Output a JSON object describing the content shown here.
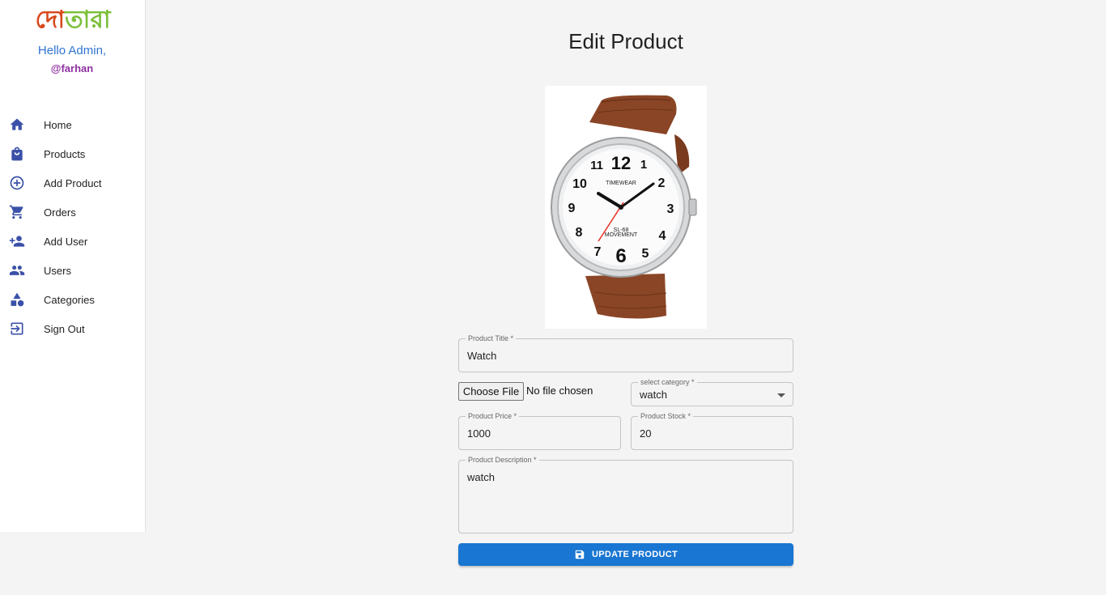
{
  "sidebar": {
    "logo_part1": "দো",
    "logo_part2": "তারা",
    "greeting": "Hello Admin,",
    "username": "@farhan",
    "items": [
      {
        "label": "Home",
        "icon": "home-icon"
      },
      {
        "label": "Products",
        "icon": "shopping-bag-icon"
      },
      {
        "label": "Add Product",
        "icon": "add-circle-icon"
      },
      {
        "label": "Orders",
        "icon": "cart-icon"
      },
      {
        "label": "Add User",
        "icon": "person-add-icon"
      },
      {
        "label": "Users",
        "icon": "people-icon"
      },
      {
        "label": "Categories",
        "icon": "category-icon"
      },
      {
        "label": "Sign Out",
        "icon": "sign-out-icon"
      }
    ]
  },
  "main": {
    "title": "Edit Product",
    "form": {
      "product_title_label": "Product Title *",
      "product_title_value": "Watch",
      "file_button": "Choose File",
      "file_status": "No file chosen",
      "category_label": "select category *",
      "category_value": "watch",
      "price_label": "Product Price *",
      "price_value": "1000",
      "stock_label": "Product Stock *",
      "stock_value": "20",
      "description_label": "Product Description *",
      "description_value": "watch",
      "submit_label": "UPDATE PRODUCT"
    },
    "product_image": {
      "brand_text": "TIMEWEAR",
      "movement_text": "SL-68",
      "movement_text2": "MOVEMENT"
    }
  },
  "colors": {
    "accent": "#1976d2",
    "nav_icon": "#3b51a8",
    "greeting": "#2f74d0",
    "username": "#8e2fa1"
  }
}
